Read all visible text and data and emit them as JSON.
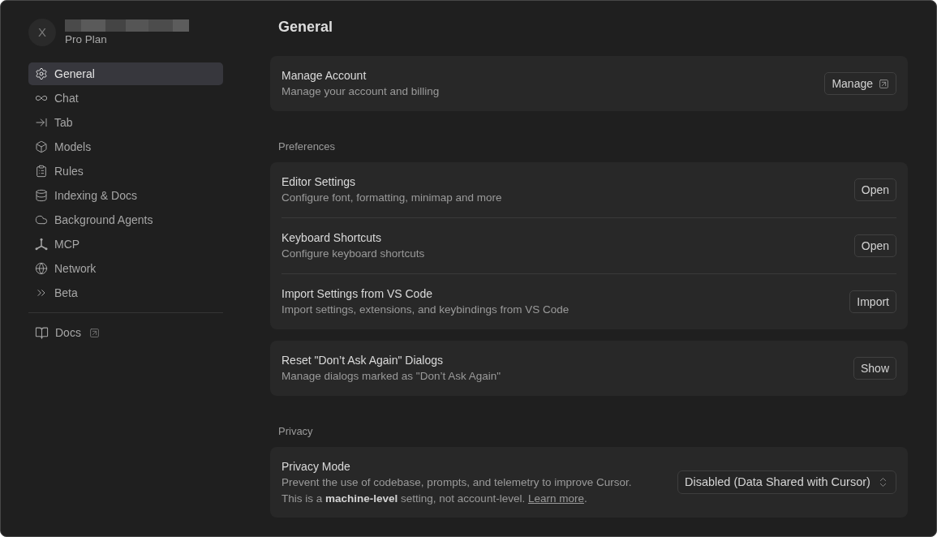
{
  "sidebar": {
    "avatar": {
      "initial": "X"
    },
    "plan": "Pro Plan",
    "nav": [
      {
        "label": "General",
        "selected": true
      },
      {
        "label": "Chat",
        "selected": false
      },
      {
        "label": "Tab",
        "selected": false
      },
      {
        "label": "Models",
        "selected": false
      },
      {
        "label": "Rules",
        "selected": false
      },
      {
        "label": "Indexing & Docs",
        "selected": false
      },
      {
        "label": "Background Agents",
        "selected": false
      },
      {
        "label": "MCP",
        "selected": false
      },
      {
        "label": "Network",
        "selected": false
      },
      {
        "label": "Beta",
        "selected": false
      }
    ],
    "links": [
      {
        "label": "Docs",
        "external": true
      }
    ]
  },
  "main": {
    "title": "General",
    "groups": [
      {
        "cards": [
          {
            "rows": [
              {
                "title": "Manage Account",
                "description": "Manage your account and billing",
                "control": {
                  "kind": "button",
                  "label": "Manage",
                  "external": true
                }
              }
            ]
          }
        ]
      },
      {
        "heading": "Preferences",
        "cards": [
          {
            "rows": [
              {
                "title": "Editor Settings",
                "description": "Configure font, formatting, minimap and more",
                "control": {
                  "kind": "button",
                  "label": "Open",
                  "external": false
                }
              },
              {
                "title": "Keyboard Shortcuts",
                "description": "Configure keyboard shortcuts",
                "control": {
                  "kind": "button",
                  "label": "Open",
                  "external": false
                }
              },
              {
                "title": "Import Settings from VS Code",
                "description": "Import settings, extensions, and keybindings from VS Code",
                "control": {
                  "kind": "button",
                  "label": "Import",
                  "external": false
                }
              }
            ]
          },
          {
            "rows": [
              {
                "title": "Reset \"Don’t Ask Again\" Dialogs",
                "description": "Manage dialogs marked as \"Don’t Ask Again\"",
                "control": {
                  "kind": "button",
                  "label": "Show",
                  "external": false
                }
              }
            ]
          }
        ]
      },
      {
        "heading": "Privacy",
        "cards": [
          {
            "rows": [
              {
                "title": "Privacy Mode",
                "description": "Prevent the use of codebase, prompts, and telemetry to improve Cursor.",
                "note": "This is a **machine-level** setting, not account-level.",
                "link": "Learn more",
                "note_end": ".",
                "control": {
                  "kind": "select",
                  "value": "Disabled (Data Shared with Cursor)"
                }
              }
            ]
          }
        ]
      }
    ]
  }
}
